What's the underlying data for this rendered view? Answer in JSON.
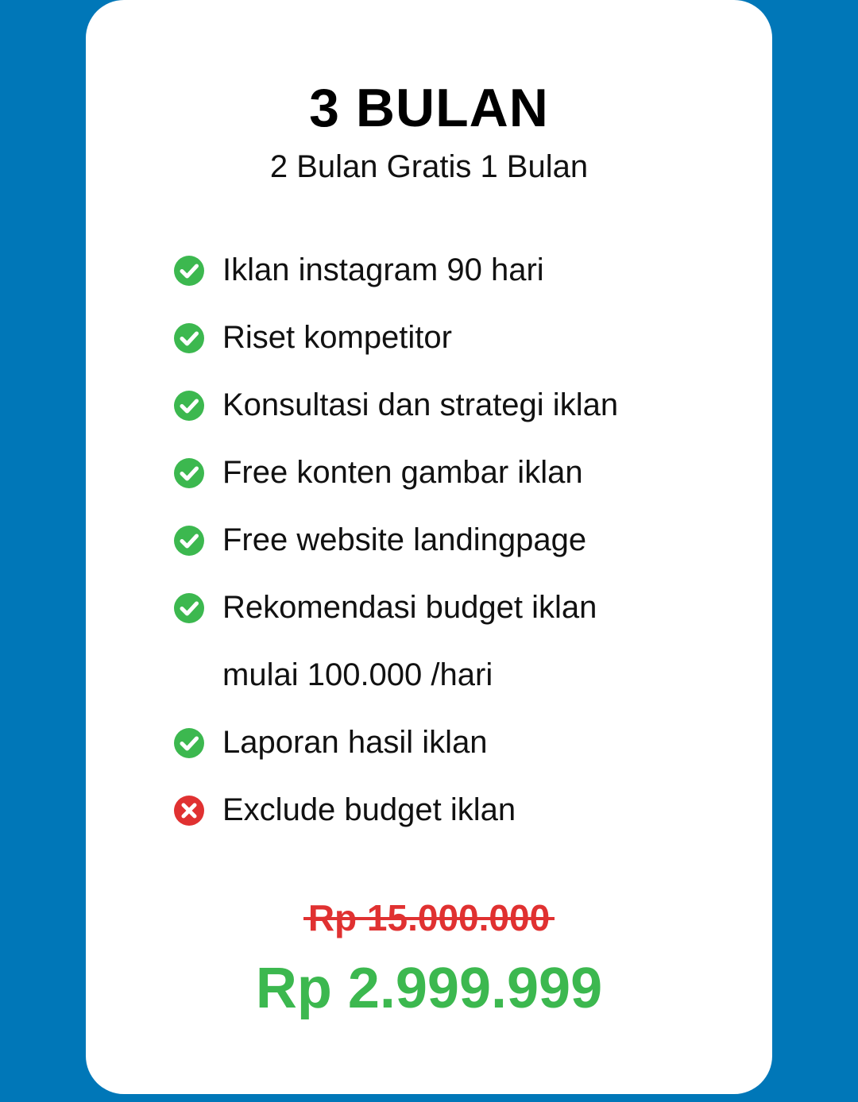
{
  "plan": {
    "title": "3 BULAN",
    "subtitle": "2 Bulan Gratis 1 Bulan"
  },
  "features": [
    {
      "text": "Iklan instagram 90 hari",
      "icon": "check-circle-icon",
      "included": true
    },
    {
      "text": "Riset kompetitor",
      "icon": "check-circle-icon",
      "included": true
    },
    {
      "text": "Konsultasi dan strategi iklan",
      "icon": "check-circle-icon",
      "included": true
    },
    {
      "text": "Free konten gambar iklan",
      "icon": "check-circle-icon",
      "included": true
    },
    {
      "text": "Free website landingpage",
      "icon": "check-circle-icon",
      "included": true
    },
    {
      "text": "Rekomendasi budget iklan",
      "icon": "check-circle-icon",
      "included": true
    },
    {
      "text": "mulai 100.000 /hari",
      "icon": "",
      "included": true
    },
    {
      "text": "Laporan hasil iklan",
      "icon": "check-circle-icon",
      "included": true
    },
    {
      "text": "Exclude budget iklan",
      "icon": "x-circle-icon",
      "included": false
    }
  ],
  "pricing": {
    "old_price": "Rp 15.000.000",
    "new_price": "Rp 2.999.999"
  },
  "colors": {
    "background": "#0077b8",
    "card": "#ffffff",
    "check": "#3cb84f",
    "cross": "#e03131",
    "old_price": "#e03131",
    "new_price": "#3cb84f"
  }
}
